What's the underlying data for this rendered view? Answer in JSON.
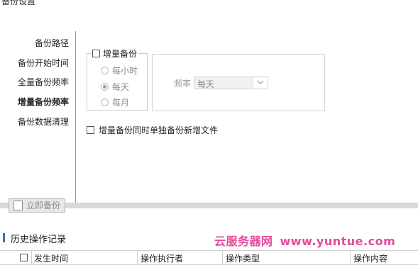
{
  "window": {
    "title": "备份设置"
  },
  "sidebar": {
    "items": [
      {
        "label": "备份路径",
        "active": false
      },
      {
        "label": "备份开始时间",
        "active": false
      },
      {
        "label": "全量备份频率",
        "active": false
      },
      {
        "label": "增量备份频率",
        "active": true
      },
      {
        "label": "备份数据清理",
        "active": false
      }
    ]
  },
  "incremental": {
    "checkbox_label": "增量备份",
    "checked": false,
    "options": [
      {
        "label": "每小时",
        "selected": false
      },
      {
        "label": "每天",
        "selected": true
      },
      {
        "label": "每月",
        "selected": false
      }
    ],
    "frequency_label": "频率",
    "frequency_value": "每天",
    "separate_label": "增量备份同时单独备份新增文件",
    "separate_checked": false
  },
  "actions": {
    "backup_now": "立即备份"
  },
  "history": {
    "title": "历史操作记录",
    "columns": [
      "发生时间",
      "操作执行者",
      "操作类型",
      "操作内容"
    ]
  },
  "watermark": {
    "text": "云服务器网",
    "url": "www.yuntue.com"
  },
  "colors": {
    "accent": "#3a6fb5",
    "watermark": "#e64a9b"
  }
}
